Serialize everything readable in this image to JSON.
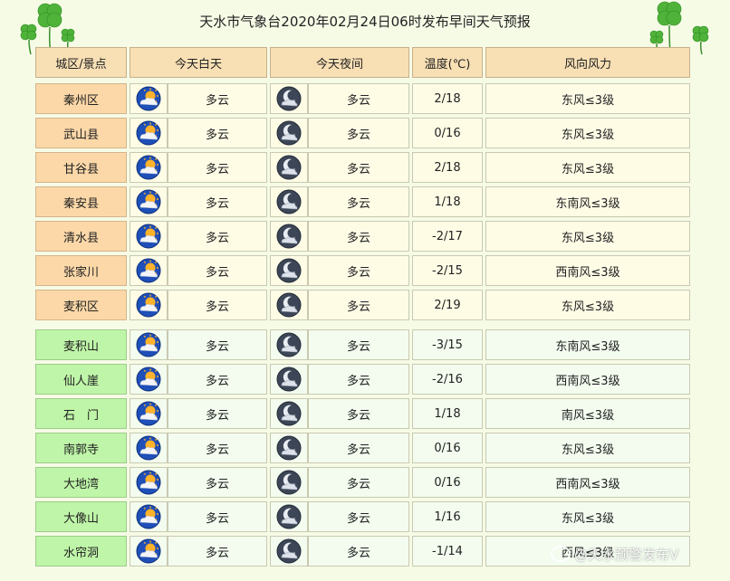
{
  "title": "天水市气象台2020年02月24日06时发布早间天气预报",
  "headers": {
    "area": "城区/景点",
    "day": "今天白天",
    "night": "今天夜间",
    "temp": "温度(℃)",
    "wind": "风向风力"
  },
  "icons": {
    "day": "partly-cloudy-day-icon",
    "night": "partly-cloudy-night-icon"
  },
  "colors": {
    "city_cell": "#fcd8a8",
    "scenic_cell": "#bff5a8",
    "header": "#f8dfb4",
    "row_bg": "#fffce6",
    "page_bg": "#f6fbe6"
  },
  "rows": [
    {
      "name": "秦州区",
      "group": "city",
      "day": "多云",
      "night": "多云",
      "temp": "2/18",
      "wind": "东风≤3级"
    },
    {
      "name": "武山县",
      "group": "city",
      "day": "多云",
      "night": "多云",
      "temp": "0/16",
      "wind": "东风≤3级"
    },
    {
      "name": "甘谷县",
      "group": "city",
      "day": "多云",
      "night": "多云",
      "temp": "2/18",
      "wind": "东风≤3级"
    },
    {
      "name": "秦安县",
      "group": "city",
      "day": "多云",
      "night": "多云",
      "temp": "1/18",
      "wind": "东南风≤3级"
    },
    {
      "name": "清水县",
      "group": "city",
      "day": "多云",
      "night": "多云",
      "temp": "-2/17",
      "wind": "东风≤3级"
    },
    {
      "name": "张家川",
      "group": "city",
      "day": "多云",
      "night": "多云",
      "temp": "-2/15",
      "wind": "西南风≤3级"
    },
    {
      "name": "麦积区",
      "group": "city",
      "day": "多云",
      "night": "多云",
      "temp": "2/19",
      "wind": "东风≤3级"
    },
    {
      "name": "麦积山",
      "group": "scenic",
      "day": "多云",
      "night": "多云",
      "temp": "-3/15",
      "wind": "东南风≤3级"
    },
    {
      "name": "仙人崖",
      "group": "scenic",
      "day": "多云",
      "night": "多云",
      "temp": "-2/16",
      "wind": "西南风≤3级"
    },
    {
      "name": "石　门",
      "group": "scenic",
      "day": "多云",
      "night": "多云",
      "temp": "1/18",
      "wind": "南风≤3级"
    },
    {
      "name": "南郭寺",
      "group": "scenic",
      "day": "多云",
      "night": "多云",
      "temp": "0/16",
      "wind": "东风≤3级"
    },
    {
      "name": "大地湾",
      "group": "scenic",
      "day": "多云",
      "night": "多云",
      "temp": "0/16",
      "wind": "西南风≤3级"
    },
    {
      "name": "大像山",
      "group": "scenic",
      "day": "多云",
      "night": "多云",
      "temp": "1/16",
      "wind": "东风≤3级"
    },
    {
      "name": "水帘洞",
      "group": "scenic",
      "day": "多云",
      "night": "多云",
      "temp": "-1/14",
      "wind": "西风≤3级"
    }
  ],
  "watermark": "@天水预警发布V"
}
